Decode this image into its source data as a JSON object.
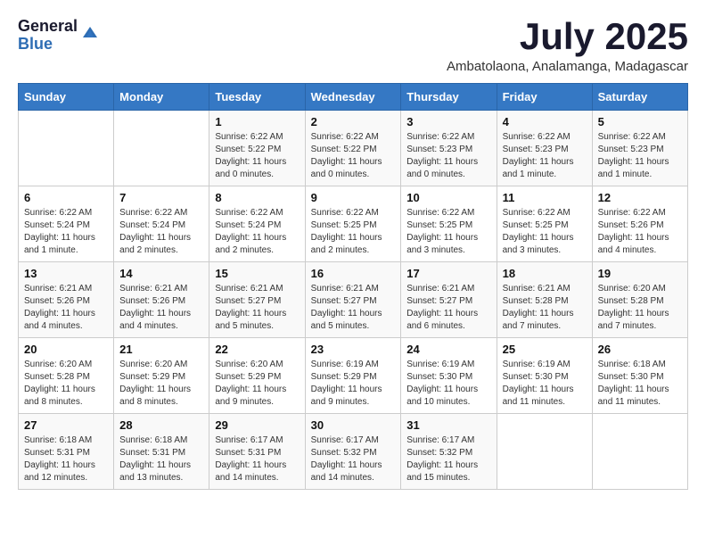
{
  "logo": {
    "general": "General",
    "blue": "Blue"
  },
  "title": "July 2025",
  "location": "Ambatolaona, Analamanga, Madagascar",
  "days_of_week": [
    "Sunday",
    "Monday",
    "Tuesday",
    "Wednesday",
    "Thursday",
    "Friday",
    "Saturday"
  ],
  "weeks": [
    [
      {
        "day": "",
        "info": ""
      },
      {
        "day": "",
        "info": ""
      },
      {
        "day": "1",
        "info": "Sunrise: 6:22 AM\nSunset: 5:22 PM\nDaylight: 11 hours and 0 minutes."
      },
      {
        "day": "2",
        "info": "Sunrise: 6:22 AM\nSunset: 5:22 PM\nDaylight: 11 hours and 0 minutes."
      },
      {
        "day": "3",
        "info": "Sunrise: 6:22 AM\nSunset: 5:23 PM\nDaylight: 11 hours and 0 minutes."
      },
      {
        "day": "4",
        "info": "Sunrise: 6:22 AM\nSunset: 5:23 PM\nDaylight: 11 hours and 1 minute."
      },
      {
        "day": "5",
        "info": "Sunrise: 6:22 AM\nSunset: 5:23 PM\nDaylight: 11 hours and 1 minute."
      }
    ],
    [
      {
        "day": "6",
        "info": "Sunrise: 6:22 AM\nSunset: 5:24 PM\nDaylight: 11 hours and 1 minute."
      },
      {
        "day": "7",
        "info": "Sunrise: 6:22 AM\nSunset: 5:24 PM\nDaylight: 11 hours and 2 minutes."
      },
      {
        "day": "8",
        "info": "Sunrise: 6:22 AM\nSunset: 5:24 PM\nDaylight: 11 hours and 2 minutes."
      },
      {
        "day": "9",
        "info": "Sunrise: 6:22 AM\nSunset: 5:25 PM\nDaylight: 11 hours and 2 minutes."
      },
      {
        "day": "10",
        "info": "Sunrise: 6:22 AM\nSunset: 5:25 PM\nDaylight: 11 hours and 3 minutes."
      },
      {
        "day": "11",
        "info": "Sunrise: 6:22 AM\nSunset: 5:25 PM\nDaylight: 11 hours and 3 minutes."
      },
      {
        "day": "12",
        "info": "Sunrise: 6:22 AM\nSunset: 5:26 PM\nDaylight: 11 hours and 4 minutes."
      }
    ],
    [
      {
        "day": "13",
        "info": "Sunrise: 6:21 AM\nSunset: 5:26 PM\nDaylight: 11 hours and 4 minutes."
      },
      {
        "day": "14",
        "info": "Sunrise: 6:21 AM\nSunset: 5:26 PM\nDaylight: 11 hours and 4 minutes."
      },
      {
        "day": "15",
        "info": "Sunrise: 6:21 AM\nSunset: 5:27 PM\nDaylight: 11 hours and 5 minutes."
      },
      {
        "day": "16",
        "info": "Sunrise: 6:21 AM\nSunset: 5:27 PM\nDaylight: 11 hours and 5 minutes."
      },
      {
        "day": "17",
        "info": "Sunrise: 6:21 AM\nSunset: 5:27 PM\nDaylight: 11 hours and 6 minutes."
      },
      {
        "day": "18",
        "info": "Sunrise: 6:21 AM\nSunset: 5:28 PM\nDaylight: 11 hours and 7 minutes."
      },
      {
        "day": "19",
        "info": "Sunrise: 6:20 AM\nSunset: 5:28 PM\nDaylight: 11 hours and 7 minutes."
      }
    ],
    [
      {
        "day": "20",
        "info": "Sunrise: 6:20 AM\nSunset: 5:28 PM\nDaylight: 11 hours and 8 minutes."
      },
      {
        "day": "21",
        "info": "Sunrise: 6:20 AM\nSunset: 5:29 PM\nDaylight: 11 hours and 8 minutes."
      },
      {
        "day": "22",
        "info": "Sunrise: 6:20 AM\nSunset: 5:29 PM\nDaylight: 11 hours and 9 minutes."
      },
      {
        "day": "23",
        "info": "Sunrise: 6:19 AM\nSunset: 5:29 PM\nDaylight: 11 hours and 9 minutes."
      },
      {
        "day": "24",
        "info": "Sunrise: 6:19 AM\nSunset: 5:30 PM\nDaylight: 11 hours and 10 minutes."
      },
      {
        "day": "25",
        "info": "Sunrise: 6:19 AM\nSunset: 5:30 PM\nDaylight: 11 hours and 11 minutes."
      },
      {
        "day": "26",
        "info": "Sunrise: 6:18 AM\nSunset: 5:30 PM\nDaylight: 11 hours and 11 minutes."
      }
    ],
    [
      {
        "day": "27",
        "info": "Sunrise: 6:18 AM\nSunset: 5:31 PM\nDaylight: 11 hours and 12 minutes."
      },
      {
        "day": "28",
        "info": "Sunrise: 6:18 AM\nSunset: 5:31 PM\nDaylight: 11 hours and 13 minutes."
      },
      {
        "day": "29",
        "info": "Sunrise: 6:17 AM\nSunset: 5:31 PM\nDaylight: 11 hours and 14 minutes."
      },
      {
        "day": "30",
        "info": "Sunrise: 6:17 AM\nSunset: 5:32 PM\nDaylight: 11 hours and 14 minutes."
      },
      {
        "day": "31",
        "info": "Sunrise: 6:17 AM\nSunset: 5:32 PM\nDaylight: 11 hours and 15 minutes."
      },
      {
        "day": "",
        "info": ""
      },
      {
        "day": "",
        "info": ""
      }
    ]
  ]
}
